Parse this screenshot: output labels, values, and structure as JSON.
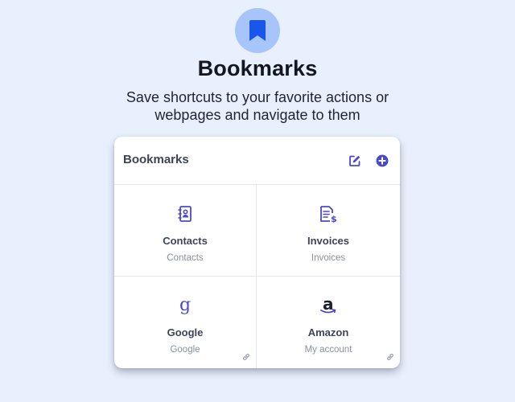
{
  "hero": {
    "icon": "bookmark-icon",
    "title": "Bookmarks",
    "subtitle": "Save shortcuts to your favorite actions or webpages and navigate to them"
  },
  "card": {
    "title": "Bookmarks",
    "edit_icon": "edit-icon",
    "add_icon": "plus-circle-icon",
    "tiles": [
      {
        "name": "Contacts",
        "subtitle": "Contacts",
        "icon": "contacts-book-icon",
        "link": false
      },
      {
        "name": "Invoices",
        "subtitle": "Invoices",
        "icon": "invoice-icon",
        "link": false
      },
      {
        "name": "Google",
        "subtitle": "Google",
        "icon": "google-g-icon",
        "glyph": "g",
        "link": true
      },
      {
        "name": "Amazon",
        "subtitle": "My account",
        "icon": "amazon-icon",
        "glyph": "a",
        "link": true
      }
    ]
  },
  "colors": {
    "background": "#e9f0fd",
    "accent": "#4b49c9",
    "hero_circle": "#a8c5fb",
    "hero_bookmark": "#1a56e8"
  }
}
